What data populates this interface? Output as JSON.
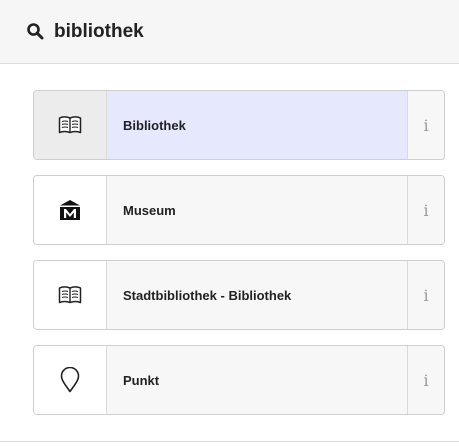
{
  "search": {
    "value": "bibliothek",
    "icon": "search-icon"
  },
  "results": [
    {
      "label": "Bibliothek",
      "icon": "book-icon",
      "selected": true,
      "info": "i"
    },
    {
      "label": "Museum",
      "icon": "museum-icon",
      "selected": false,
      "info": "i"
    },
    {
      "label": "Stadtbibliothek - Bibliothek",
      "icon": "book-icon",
      "selected": false,
      "info": "i"
    },
    {
      "label": "Punkt",
      "icon": "map-pin-icon",
      "selected": false,
      "info": "i"
    }
  ],
  "colors": {
    "header_bg": "#f6f6f6",
    "selected_label_bg": "#e6e9fd",
    "selected_icon_bg": "#ececec",
    "item_bg": "#f7f7f7",
    "border": "#cfcfcf",
    "info_text": "#9a9a9a"
  }
}
